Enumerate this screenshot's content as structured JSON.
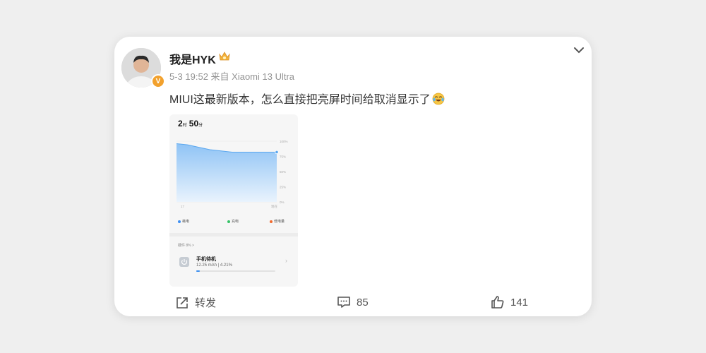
{
  "post": {
    "username": "我是HYK",
    "verified_badge": "V",
    "meta": "5-3 19:52 来自 Xiaomi 13 Ultra",
    "content": "MIUI这最新版本，怎么直接把亮屏时间给取消显示了"
  },
  "screenshot": {
    "hours": "2",
    "hour_unit": "时",
    "minutes": "50",
    "minute_unit": "分",
    "chart_data": {
      "type": "area",
      "x_labels": [
        "17",
        "现在"
      ],
      "y_ticks": [
        "100%",
        "75%",
        "50%",
        "25%",
        "0%"
      ],
      "ylim": [
        0,
        100
      ],
      "series": [
        {
          "values": [
            96,
            94,
            90,
            86,
            84,
            82,
            82,
            82,
            82,
            82
          ]
        }
      ]
    },
    "legend": [
      {
        "label": "耗电",
        "color": "#3e8ff2"
      },
      {
        "label": "充电",
        "color": "#36c267"
      },
      {
        "label": "低电量",
        "color": "#f26a2e"
      }
    ],
    "hardware_label": "硬件 8% >",
    "item": {
      "name": "手机待机",
      "detail": "12.25 mAh | 4.21%",
      "percent": 4.21
    }
  },
  "actions": {
    "repost": "转发",
    "comments": "85",
    "likes": "141"
  }
}
